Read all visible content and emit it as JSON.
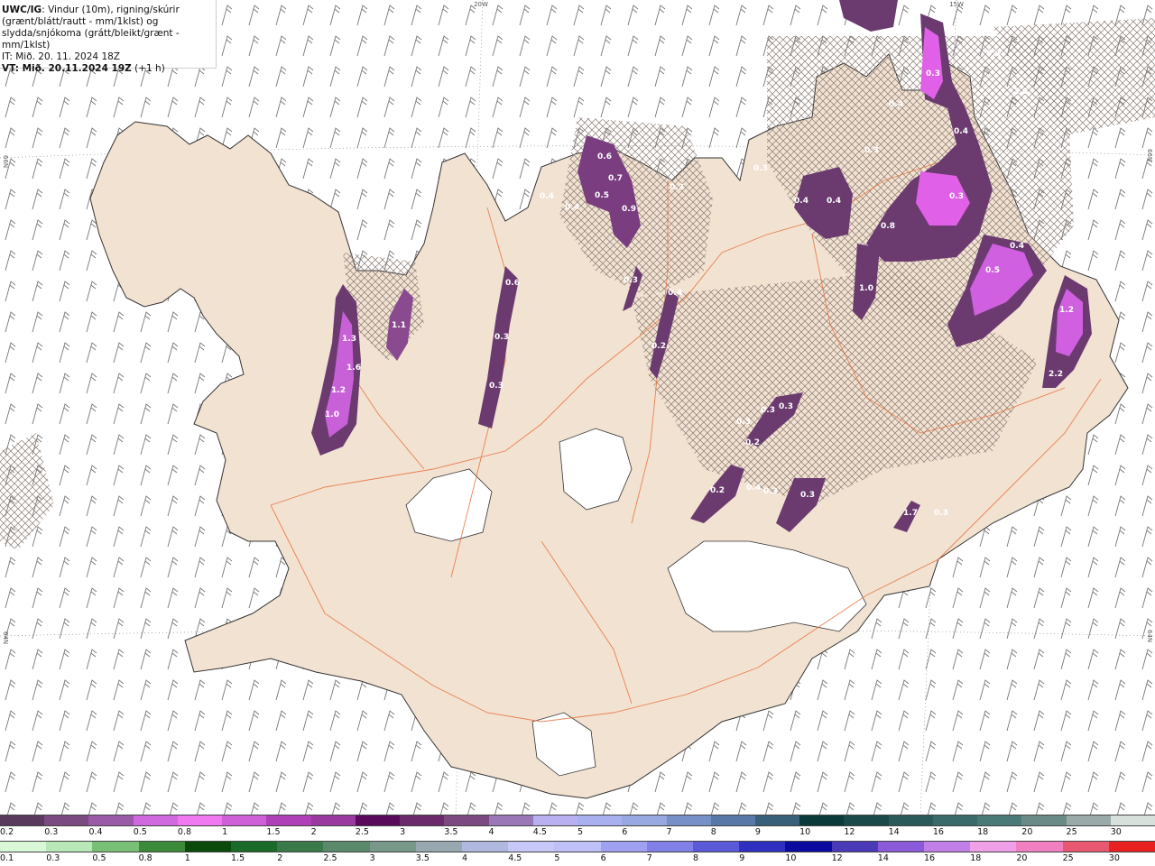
{
  "title": {
    "product": "UWC/IG",
    "description": ": Vindur (10m), rigning/skúrir (grænt/blátt/rautt - mm/1klst) og slydda/snjókoma (grátt/bleikt/grænt - mm/1klst)",
    "it_label": "IT: Mið. 20. 11. 2024 18Z",
    "vt_label": "VT: Mið. 20.11.2024 19Z",
    "vt_offset": "(+1 h)"
  },
  "grid_labels": {
    "top_20w": "20W",
    "top_15w": "15W",
    "left_66n": "66N",
    "right_66n": "66N",
    "left_64n": "64N",
    "right_64n": "64N"
  },
  "colors": {
    "land": "#f2e2d2",
    "roads": "#e8703a",
    "coast": "#333333",
    "hatch": "#8a7a72",
    "precip_light": "#6b3b70",
    "precip_mid": "#b050c0",
    "precip_high": "#e860e8"
  },
  "map_labels": [
    "1.3",
    "1.6",
    "1.2",
    "1.0",
    "1.1",
    "0.6",
    "0.3",
    "0.3",
    "0.4",
    "0.4",
    "0.6",
    "0.5",
    "0.7",
    "0.9",
    "0.3",
    "0.3",
    "0.4",
    "0.2",
    "0.3",
    "0.4",
    "0.4",
    "0.3",
    "0.4",
    "1.6",
    "0.3",
    "0.4",
    "0.3",
    "0.8",
    "1.0",
    "0.4",
    "0.5",
    "1.2",
    "2.2",
    "1.7",
    "0.3",
    "0.3",
    "0.3",
    "0.2",
    "0.4",
    "0.3",
    "0.3",
    "0.3",
    "0.3",
    "0.2"
  ],
  "legend_snow": {
    "ticks": [
      "0.2",
      "0.3",
      "0.4",
      "0.5",
      "0.8",
      "1",
      "1.5",
      "2",
      "2.5",
      "3",
      "3.5",
      "4",
      "4.5",
      "5",
      "6",
      "7",
      "8",
      "9",
      "10",
      "12",
      "14",
      "16",
      "18",
      "20",
      "25",
      "30"
    ],
    "colors": [
      "#5a3a5c",
      "#7a4a80",
      "#9a5aa8",
      "#d068e0",
      "#f078f0",
      "#d060d8",
      "#b040b8",
      "#9a3aa0",
      "#5a0a5a",
      "#6a2a6c",
      "#7c4a80",
      "#9a78b8",
      "#b8b0f0",
      "#a8b0f0",
      "#98a8e0",
      "#7890c8",
      "#5878a8",
      "#386078",
      "#0a3a3a",
      "#1a4a4a",
      "#2a5a5a",
      "#3a6a6a",
      "#4a7a78",
      "#6a8a88",
      "#9aaaa8",
      "#d8e0dc"
    ]
  },
  "legend_rain": {
    "ticks": [
      "0.1",
      "0.3",
      "0.5",
      "0.8",
      "1",
      "1.5",
      "2",
      "2.5",
      "3",
      "3.5",
      "4",
      "4.5",
      "5",
      "6",
      "7",
      "8",
      "9",
      "10",
      "12",
      "14",
      "16",
      "18",
      "20",
      "25",
      "30"
    ],
    "colors": [
      "#d8f8d8",
      "#b8e8b8",
      "#78c078",
      "#3a8a3a",
      "#0a4a0a",
      "#1a6a2a",
      "#3a7a4a",
      "#5a8a6a",
      "#78988a",
      "#98a8b0",
      "#b0b8e0",
      "#c8c8f8",
      "#c0c0f8",
      "#a0a0f0",
      "#8080e8",
      "#5a5ad8",
      "#3030c0",
      "#0a0aa0",
      "#4a3ab8",
      "#8a5ad8",
      "#c080e8",
      "#f0a0e8",
      "#f080c0",
      "#e85870",
      "#e82020"
    ]
  }
}
